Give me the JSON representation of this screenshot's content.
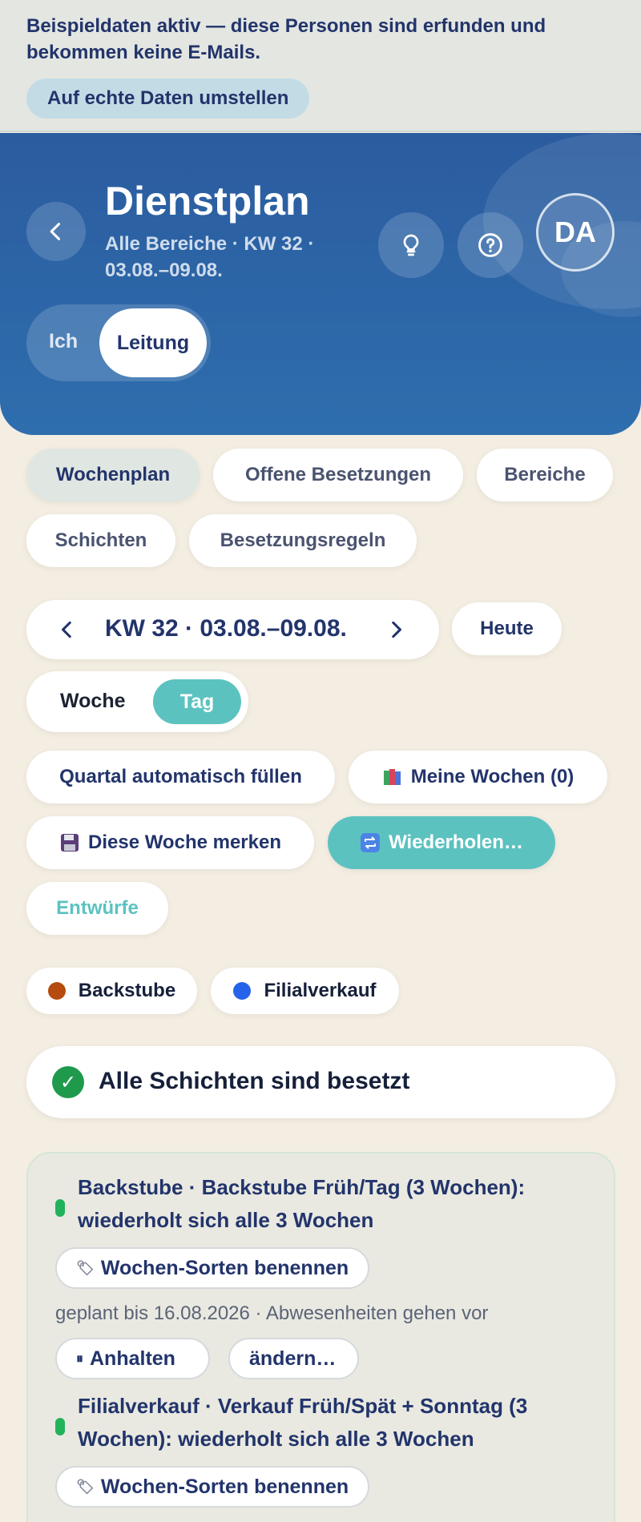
{
  "banner": {
    "text": "Beispieldaten aktiv — diese Personen sind erfunden und bekommen keine E-Mails.",
    "button": "Auf echte Daten umstellen"
  },
  "header": {
    "title": "Dienstplan",
    "subtitle": "Alle Bereiche · KW 32 · 03.08.–09.08.",
    "avatar_initials": "DA",
    "role_options": [
      "Ich",
      "Leitung"
    ],
    "role_selected": "Leitung",
    "icons": [
      "back-icon",
      "lightbulb-icon",
      "help-icon"
    ]
  },
  "tabs": [
    "Wochenplan",
    "Offene Besetzungen",
    "Bereiche",
    "Schichten",
    "Besetzungsregeln"
  ],
  "tab_active": "Wochenplan",
  "week_nav": {
    "label": "KW 32 · 03.08.–09.08.",
    "today": "Heute"
  },
  "view_toggle": {
    "options": [
      "Woche",
      "Tag"
    ],
    "selected": "Tag"
  },
  "actions": {
    "fill_quarter": "Quartal automatisch füllen",
    "my_weeks": "Meine Wochen (0)",
    "save_week": "Diese Woche merken",
    "repeat": "Wiederholen…",
    "drafts": "Entwürfe"
  },
  "legend": [
    {
      "label": "Backstube",
      "color": "#b54b0e"
    },
    {
      "label": "Filialverkauf",
      "color": "#2563eb"
    }
  ],
  "status": {
    "text": "Alle Schichten sind besetzt",
    "color": "#1f9a4c"
  },
  "repeats": [
    {
      "title": "Backstube · Backstube Früh/Tag (3 Wochen): wiederholt sich alle 3 Wochen",
      "name_button": "Wochen-Sorten benennen",
      "meta": "geplant bis 16.08.2026 · Abwesenheiten gehen vor",
      "pause_button": "Anhalten",
      "edit_button": "ändern…"
    },
    {
      "title": "Filialverkauf · Verkauf Früh/Spät + Sonntag (3 Wochen): wiederholt sich alle 3 Wochen",
      "name_button": "Wochen-Sorten benennen"
    }
  ],
  "colors": {
    "accent_teal": "#5cc2c0",
    "header_blue": "#2b5c9f",
    "navy_text": "#22346b"
  }
}
